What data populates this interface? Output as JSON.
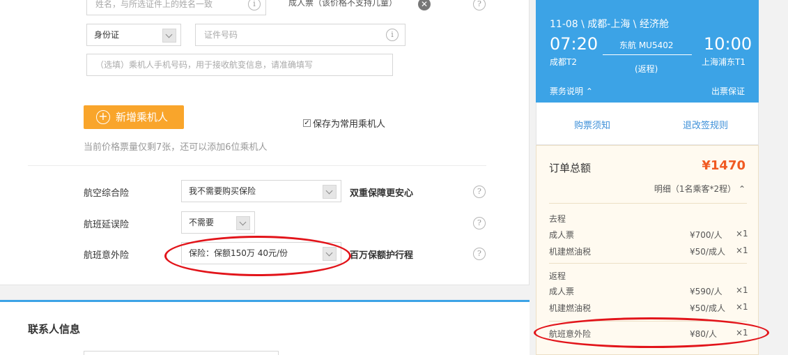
{
  "passenger": {
    "name_placeholder": "姓名，与所选证件上的姓名一致",
    "ticket_type_note": "成人票（该价格不支持儿童）",
    "id_type": "身份证",
    "id_number_placeholder": "证件号码",
    "phone_placeholder": "（选填）乘机人手机号码，用于接收航变信息，请准确填写",
    "add_button": "新增乘机人",
    "save_frequent": "保存为常用乘机人",
    "remaining_note": "当前价格票量仅剩7张，还可以添加6位乘机人"
  },
  "insurance": {
    "rows": [
      {
        "label": "航空综合险",
        "value": "我不需要购买保险",
        "promo": "双重保障更安心"
      },
      {
        "label": "航班延误险",
        "value": "不需要",
        "promo": ""
      },
      {
        "label": "航班意外险",
        "value": "保险：保额150万 40元/份",
        "promo": "百万保额护行程"
      }
    ]
  },
  "contact": {
    "title": "联系人信息"
  },
  "flight": {
    "route": "11-08 \\ 成都-上海 \\ 经济舱",
    "depart_time": "07:20",
    "arrive_time": "10:00",
    "flight_no": "东航 MU5402",
    "depart_airport": "成都T2",
    "arrive_airport": "上海浦东T1",
    "trip_type": "(返程)",
    "ticket_notes": "票务说明",
    "guarantee": "出票保证",
    "purchase_info": "购票须知",
    "refund_rules": "退改签规则"
  },
  "order": {
    "total_label": "订单总额",
    "total_value": "¥1470",
    "detail_label": "明细（1名乘客*2程）",
    "outbound": {
      "title": "去程",
      "items": [
        {
          "name": "成人票",
          "price": "¥700/人",
          "qty": "×1"
        },
        {
          "name": "机建燃油税",
          "price": "¥50/成人",
          "qty": "×1"
        }
      ]
    },
    "return": {
      "title": "返程",
      "items": [
        {
          "name": "成人票",
          "price": "¥590/人",
          "qty": "×1"
        },
        {
          "name": "机建燃油税",
          "price": "¥50/成人",
          "qty": "×1"
        }
      ]
    },
    "extras": [
      {
        "name": "航班意外险",
        "price": "¥80/人",
        "qty": "×1"
      }
    ]
  },
  "colors": {
    "accent_blue": "#3ca3e6",
    "orange_button": "#f9a52b",
    "price_orange": "#f05a22",
    "annotation_red": "#e2141a"
  }
}
